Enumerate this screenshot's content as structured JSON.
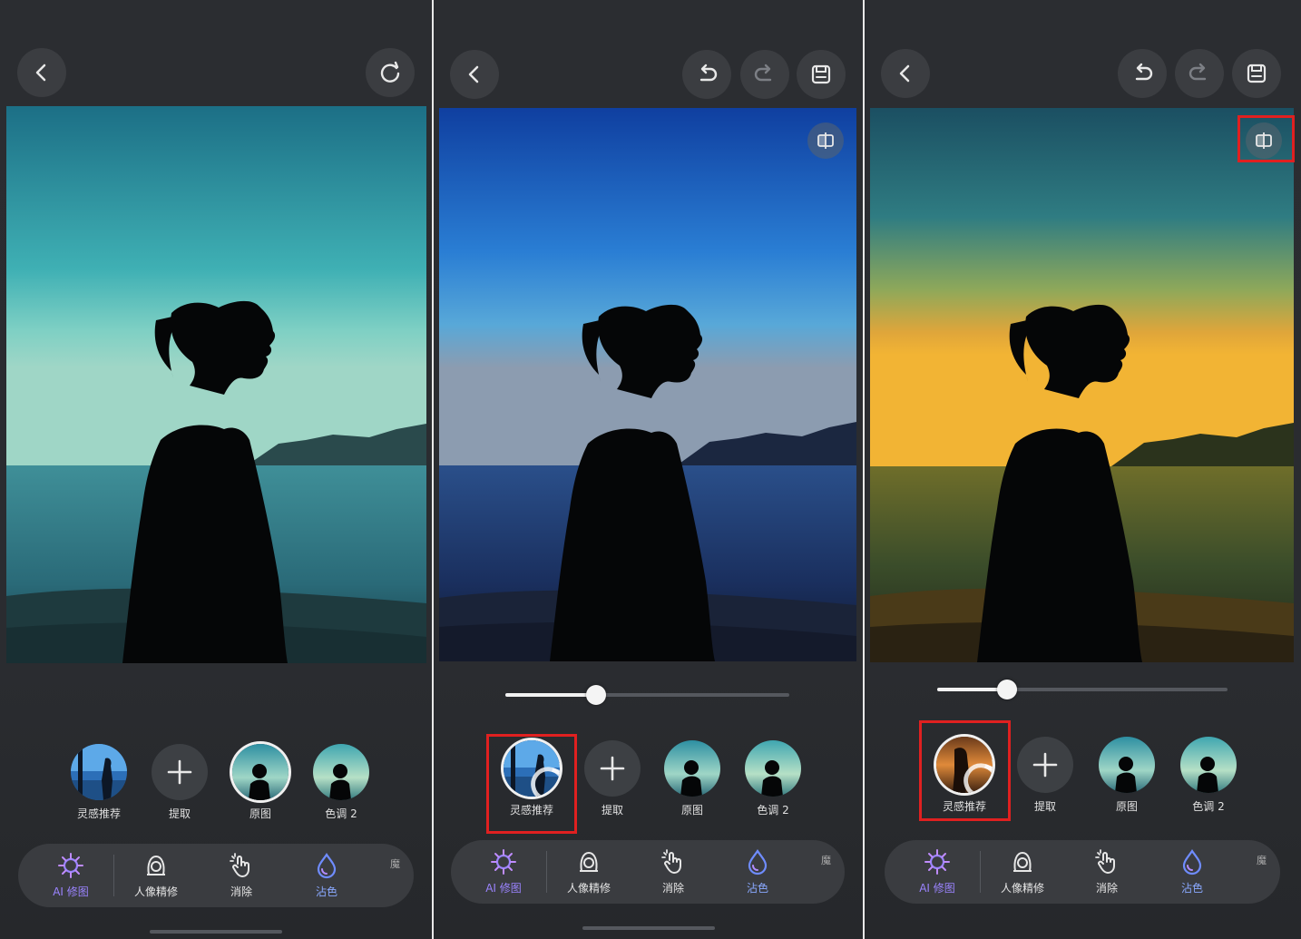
{
  "toolbar": {
    "ai_label": "AI 修图",
    "portrait_label": "人像精修",
    "erase_label": "消除",
    "color_label": "沾色",
    "more_label": "魔"
  },
  "thumbnails": {
    "inspire": "灵感推荐",
    "extract": "提取",
    "original": "原图",
    "tone2": "色调 2"
  },
  "panels": [
    {
      "id": "panel-1",
      "slider_value": null
    },
    {
      "id": "panel-2",
      "slider_value": 0.32
    },
    {
      "id": "panel-3",
      "slider_value": 0.24
    }
  ],
  "icons": {
    "back": "chevron-left-icon",
    "reset": "refresh-icon",
    "undo": "undo-icon",
    "redo": "redo-icon",
    "save": "save-icon",
    "compare": "compare-icon"
  },
  "colors": {
    "highlight": "#e02020",
    "accent_purple": "#9b84ff",
    "accent_blue": "#8aa9ff"
  }
}
